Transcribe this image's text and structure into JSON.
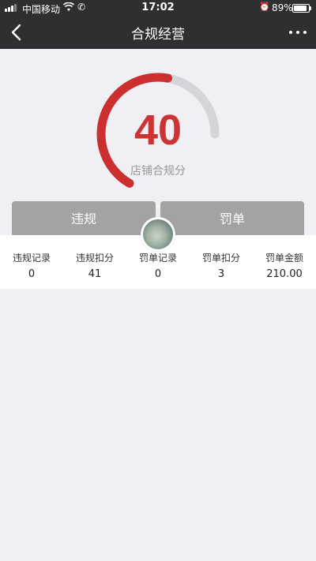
{
  "status_bar": {
    "carrier": "中国移动",
    "time": "17:02",
    "battery_percent": "89%",
    "battery_level": 0.89,
    "signal_bars": 3,
    "icons": [
      "signal-icon",
      "wifi-icon",
      "call-icon",
      "alarm-icon",
      "battery-icon"
    ]
  },
  "nav": {
    "title": "合规经营",
    "back_icon": "chevron-left-icon",
    "more_icon": "more-dots-icon"
  },
  "gauge": {
    "score": "40",
    "label": "店铺合规分",
    "score_value": 40,
    "max_value": 60,
    "colors": {
      "filled": "#cc2f2f",
      "track": "#d5d5d7"
    }
  },
  "tabs": [
    {
      "label": "违规"
    },
    {
      "label": "罚单"
    }
  ],
  "stats": [
    {
      "label": "违规记录",
      "value": "0"
    },
    {
      "label": "违规扣分",
      "value": "41"
    },
    {
      "label": "罚单记录",
      "value": "0"
    },
    {
      "label": "罚单扣分",
      "value": "3"
    },
    {
      "label": "罚单金额",
      "value": "210.00"
    }
  ],
  "colors": {
    "header_bg": "#2e2f31",
    "page_bg": "#efeff4",
    "tab_bg": "#a3a3a3",
    "score_color": "#cc3333"
  }
}
